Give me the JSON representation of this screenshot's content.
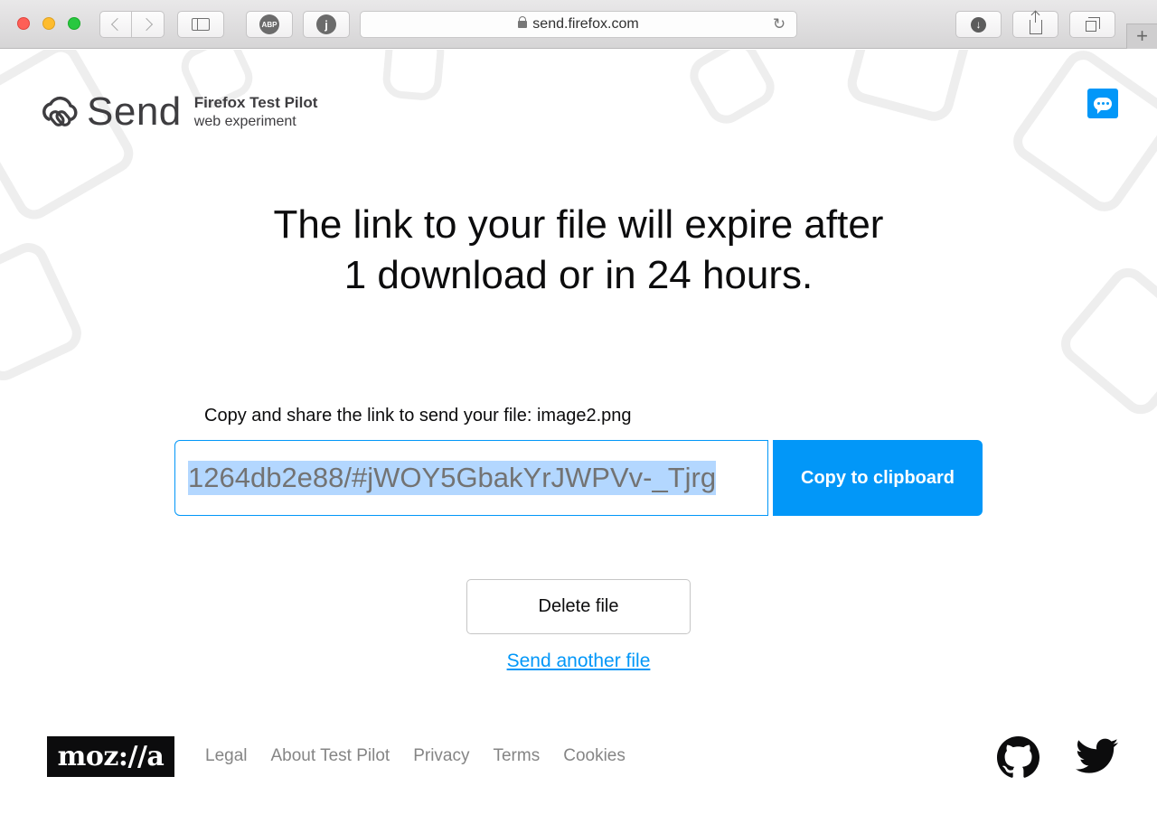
{
  "browser": {
    "url": "send.firefox.com",
    "ext_abp_label": "ABP",
    "ext_j_label": "j",
    "new_tab_label": "+"
  },
  "header": {
    "logo_title": "Send",
    "subtitle_line1": "Firefox Test Pilot",
    "subtitle_line2": "web experiment"
  },
  "main": {
    "headline_line1": "The link to your file will expire after",
    "headline_line2": "1 download or in 24 hours.",
    "share_label": "Copy and share the link to send your file: image2.png",
    "link_value": "1264db2e88/#jWOY5GbakYrJWPVv-_Tjrg",
    "copy_button": "Copy to clipboard",
    "delete_button": "Delete file",
    "send_another": "Send another file"
  },
  "footer": {
    "logo": "moz://a",
    "links": [
      "Legal",
      "About Test Pilot",
      "Privacy",
      "Terms",
      "Cookies"
    ]
  },
  "colors": {
    "accent": "#0297f8",
    "text": "#0c0c0d",
    "muted": "#858585"
  }
}
